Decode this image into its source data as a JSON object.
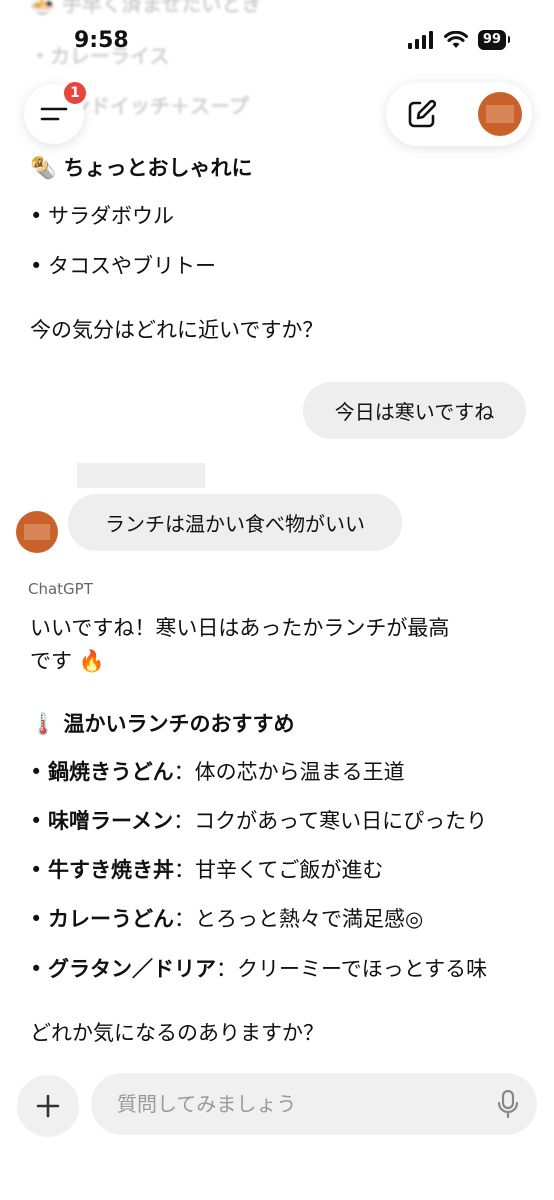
{
  "status_bar": {
    "time": "9:58",
    "battery": "99"
  },
  "faded_scroll": [
    "🍜 手早く済ませたいとき",
    "・カレーライス",
    "・サンドイッチ＋スープ"
  ],
  "header": {
    "menu_badge": "1"
  },
  "prev_reply": {
    "heading_icon": "🌯",
    "heading": "ちょっとおしゃれに",
    "items": [
      "サラダボウル",
      "タコスやブリトー"
    ],
    "question": "今の気分はどれに近いですか？"
  },
  "user_messages": [
    "今日は寒いですね",
    "ランチは温かい食べ物がいい"
  ],
  "assistant": {
    "label": "ChatGPT",
    "intro_line1": "いいですね！寒い日はあったかランチが最高",
    "intro_line2": "です",
    "intro_emoji": "🔥",
    "heading_icon": "🌡️",
    "heading": "温かいランチのおすすめ",
    "items": [
      {
        "name": "鍋焼きうどん",
        "desc": "：体の芯から温まる王道"
      },
      {
        "name": "味噌ラーメン",
        "desc": "：コクがあって寒い日にぴったり"
      },
      {
        "name": "牛すき焼き丼",
        "desc": "：甘辛くてご飯が進む"
      },
      {
        "name": "カレーうどん",
        "desc": "：とろっと熱々で満足感◎"
      },
      {
        "name": "グラタン／ドリア",
        "desc": "：クリーミーでほっとする味"
      }
    ],
    "closing": "どれか気になるのありますか？"
  },
  "composer": {
    "placeholder": "質問してみましょう"
  },
  "colors": {
    "avatar": "#c9622a",
    "badge": "#e8453c",
    "bubble": "#eeeeee"
  }
}
